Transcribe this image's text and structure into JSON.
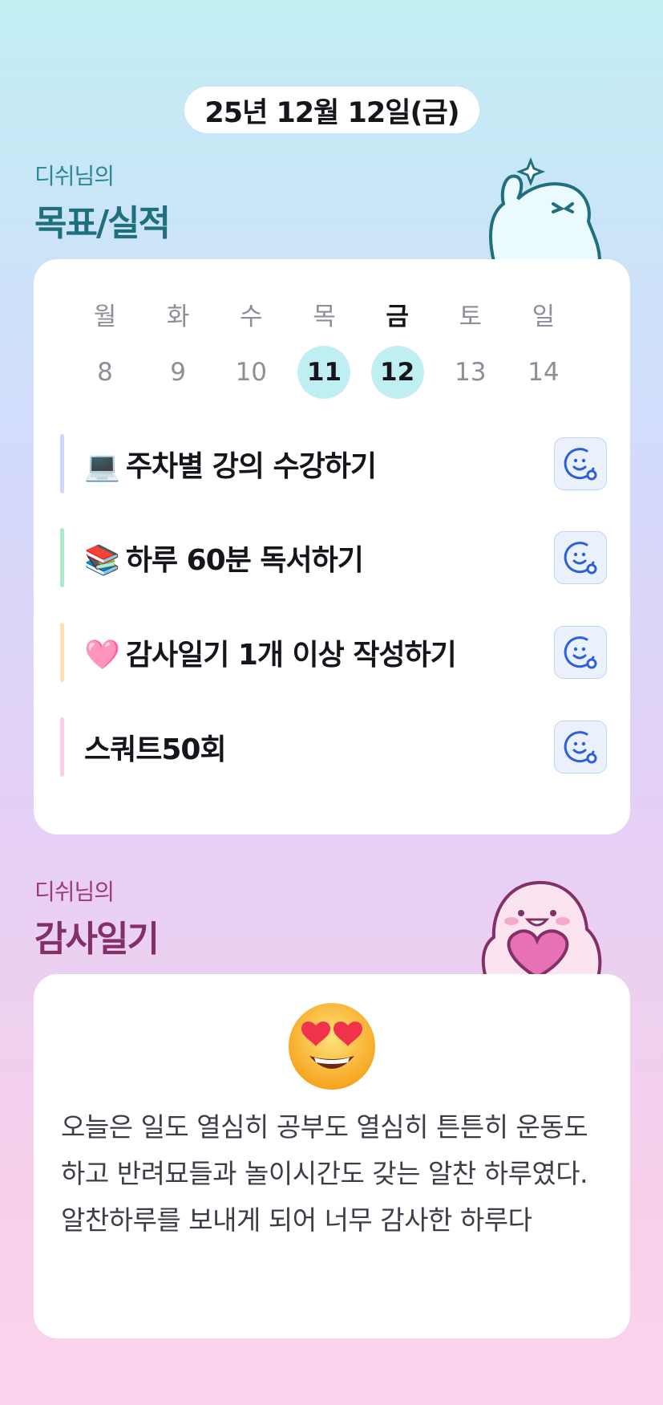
{
  "date": "25년 12월 12일(금)",
  "goals_section": {
    "subtitle": "디쉬님의",
    "title": "목표/실적"
  },
  "calendar": {
    "weekdays": [
      "월",
      "화",
      "수",
      "목",
      "금",
      "토",
      "일"
    ],
    "dates": [
      "8",
      "9",
      "10",
      "11",
      "12",
      "13",
      "14"
    ],
    "today_index": 4,
    "marked_indices": [
      3,
      4
    ]
  },
  "goals": [
    {
      "emoji": "💻",
      "label": "주차별 강의 수강하기",
      "bar_color": "#cdd6fb"
    },
    {
      "emoji": "📚",
      "label": "하루 60분 독서하기",
      "bar_color": "#aee9cd"
    },
    {
      "emoji": "🩷",
      "label": "감사일기 1개 이상 작성하기",
      "bar_color": "#fde0b6"
    },
    {
      "emoji": "",
      "label": "스쿼트50회",
      "bar_color": "#f9cfe6"
    }
  ],
  "gratitude_section": {
    "subtitle": "디쉬님의",
    "title": "감사일기",
    "mood_icon": "heart-eyes-emoji",
    "text": "오늘은 일도 열심히 공부도 열심히 튼튼히 운동도 하고 반려묘들과 놀이시간도 갖는 알찬 하루였다.알찬하루를 보내게 되어 너무 감사한 하루다"
  },
  "colors": {
    "accent_teal": "#1f6f7c",
    "accent_plum": "#823066",
    "date_highlight": "#bfeff2",
    "action_icon": "#2b5fe0"
  }
}
